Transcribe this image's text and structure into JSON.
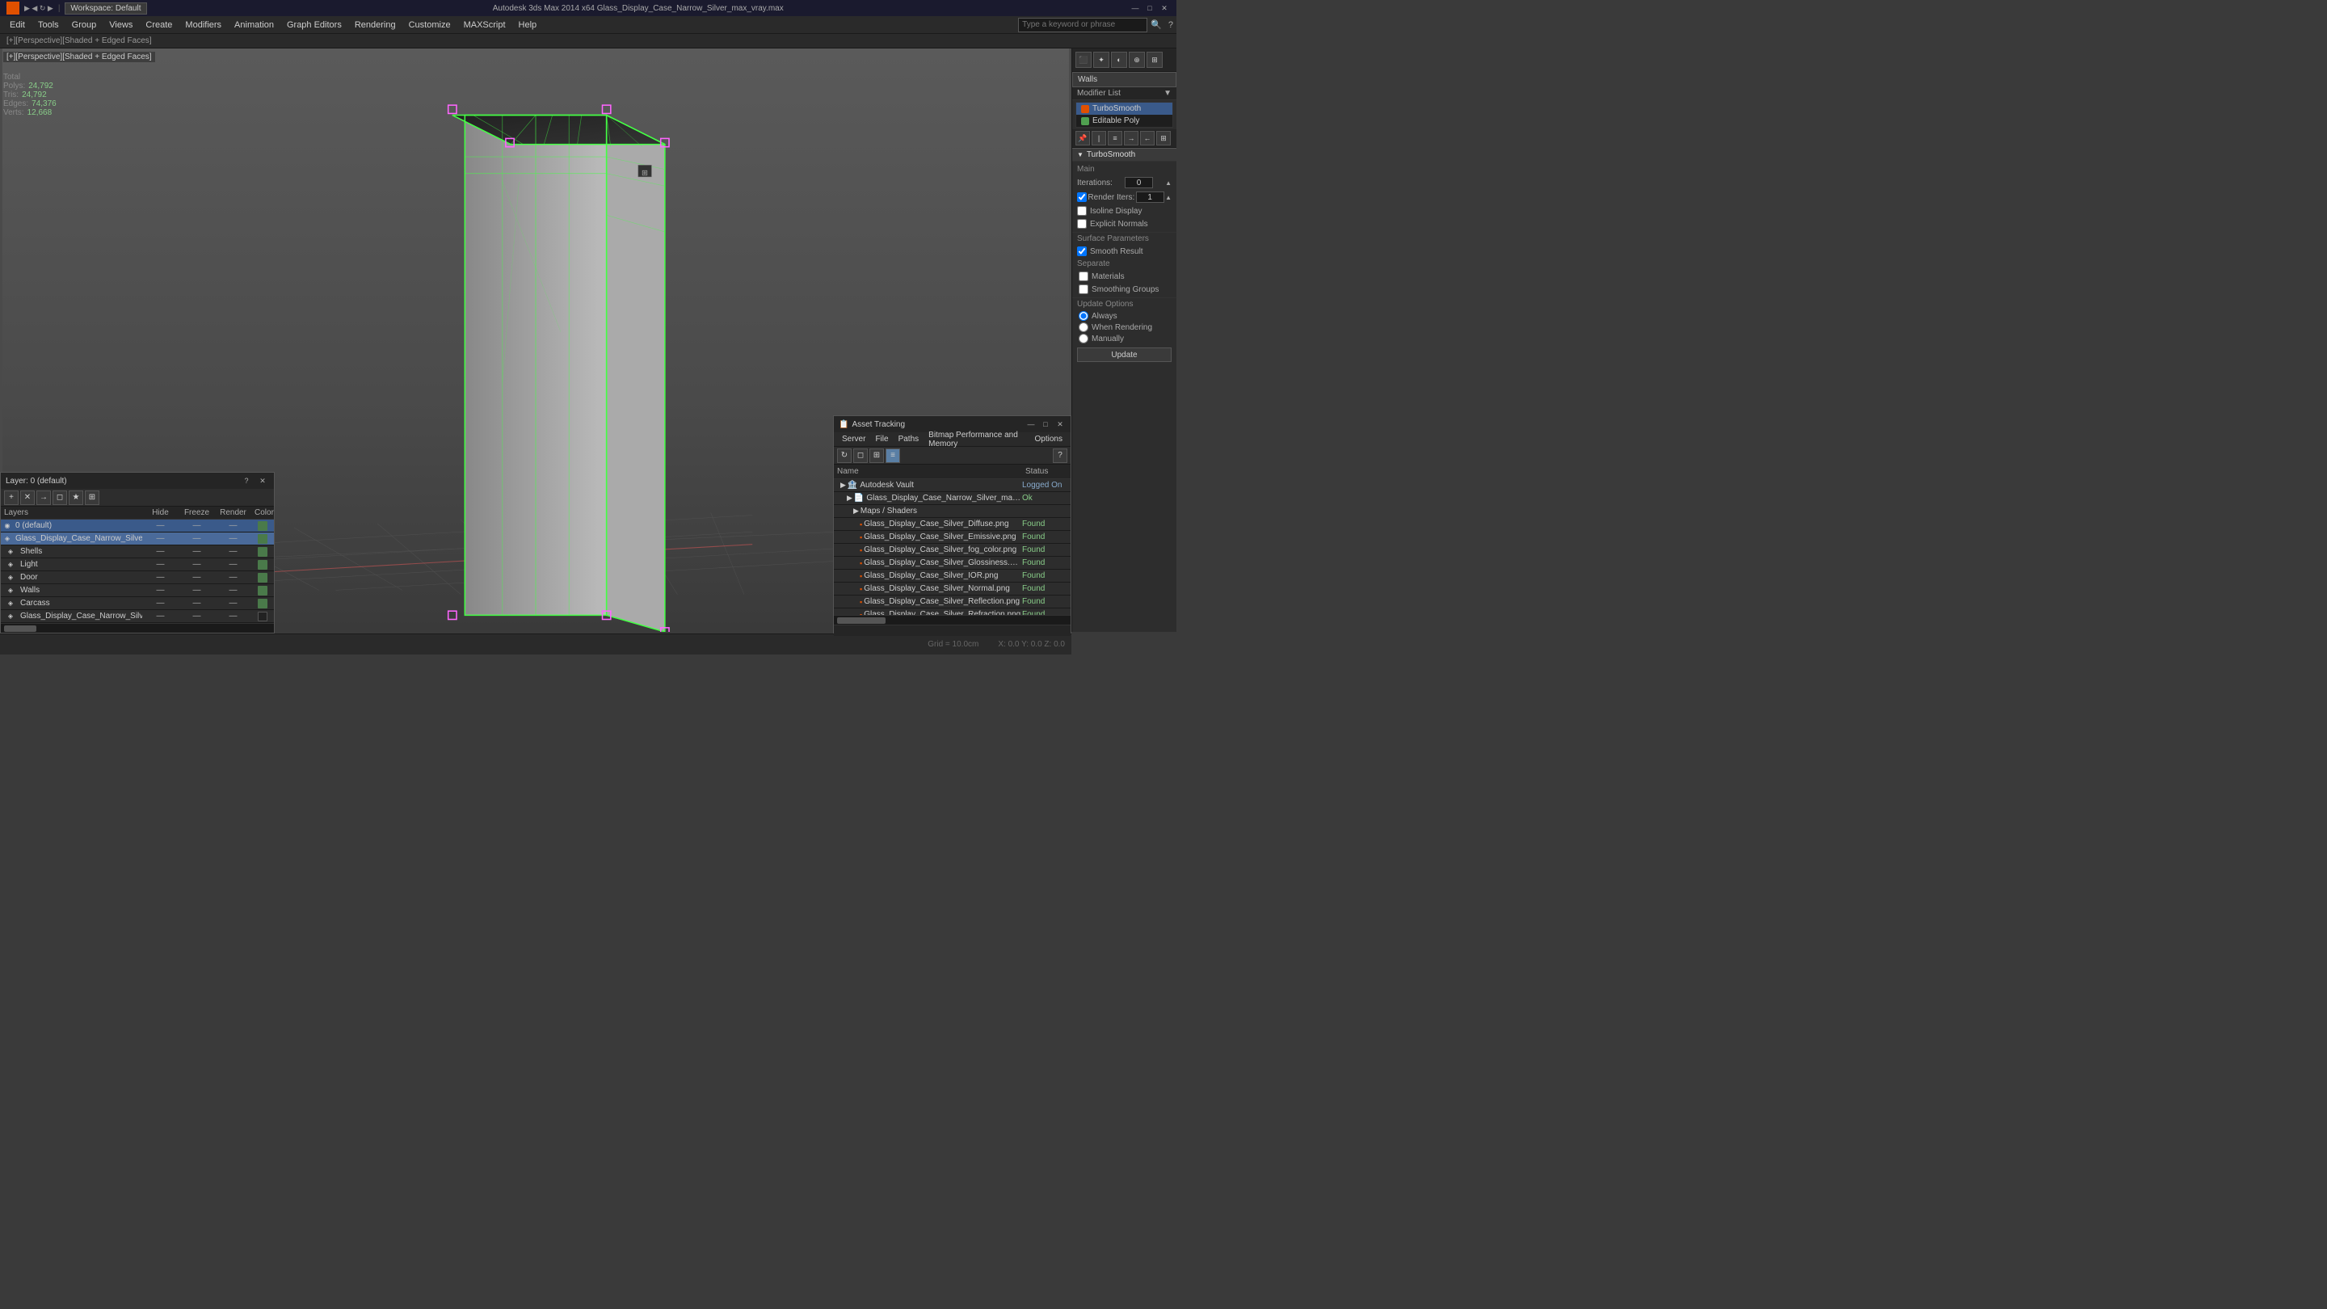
{
  "titlebar": {
    "title": "Glass_Display_Case_Narrow_Silver_max_vray.max",
    "app_title": "Autodesk 3ds Max 2014 x64",
    "full_title": "Autodesk 3ds Max 2014 x64    Glass_Display_Case_Narrow_Silver_max_vray.max",
    "minimize": "—",
    "maximize": "□",
    "close": "✕"
  },
  "toolbar": {
    "workspace_label": "Workspace: Default"
  },
  "menubar": {
    "items": [
      "Edit",
      "Tools",
      "Group",
      "Views",
      "Create",
      "Modifiers",
      "Animation",
      "Graph Editors",
      "Rendering",
      "Customize",
      "MAXScript",
      "Help"
    ],
    "search_placeholder": "Type a keyword or phrase"
  },
  "statusbar_top": {
    "label": "[+][Perspective][Shaded + Edged Faces]"
  },
  "stats": {
    "polys_label": "Polys:",
    "polys_val": "24,792",
    "tris_label": "Tris:",
    "tris_val": "24,792",
    "edges_label": "Edges:",
    "edges_val": "74,376",
    "verts_label": "Verts:",
    "verts_val": "12,668",
    "total_label": "Total"
  },
  "right_panel": {
    "object_name": "Walls",
    "modifier_list_label": "Modifier List",
    "modifiers": [
      {
        "name": "TurboSmooth",
        "type": "orange"
      },
      {
        "name": "Editable Poly",
        "type": "green"
      }
    ],
    "turbosmooth_title": "TurboSmooth",
    "main_label": "Main",
    "iterations_label": "Iterations:",
    "iterations_val": "0",
    "render_iters_label": "Render Iters:",
    "render_iters_val": "1",
    "render_iters_checked": true,
    "isoline_label": "Isoline Display",
    "isoline_checked": false,
    "explicit_normals_label": "Explicit Normals",
    "explicit_normals_checked": false,
    "surface_params_label": "Surface Parameters",
    "smooth_result_label": "Smooth Result",
    "smooth_result_checked": true,
    "separate_label": "Separate",
    "materials_label": "Materials",
    "materials_checked": false,
    "smoothing_groups_label": "Smoothing Groups",
    "smoothing_groups_checked": false,
    "update_options_label": "Update Options",
    "always_label": "Always",
    "always_checked": true,
    "when_rendering_label": "When Rendering",
    "when_rendering_checked": false,
    "manually_label": "Manually",
    "manually_checked": false,
    "update_btn": "Update"
  },
  "layers_panel": {
    "title": "Layer: 0 (default)",
    "layers_label": "Layers",
    "hide_col": "Hide",
    "freeze_col": "Freeze",
    "render_col": "Render",
    "color_col": "Color",
    "layers": [
      {
        "name": "0 (default)",
        "indent": 0,
        "active": true,
        "hide": "—",
        "freeze": "—",
        "render": "—",
        "color": "#4a7a4a"
      },
      {
        "name": "Glass_Display_Case_Narrow_Silver",
        "indent": 0,
        "active": false,
        "selected": true,
        "hide": "—",
        "freeze": "—",
        "render": "—",
        "color": "#4a7a4a"
      },
      {
        "name": "Shells",
        "indent": 1,
        "active": false,
        "hide": "—",
        "freeze": "—",
        "render": "—",
        "color": "#4a7a4a"
      },
      {
        "name": "Light",
        "indent": 1,
        "active": false,
        "hide": "—",
        "freeze": "—",
        "render": "—",
        "color": "#4a7a4a"
      },
      {
        "name": "Door",
        "indent": 1,
        "active": false,
        "hide": "—",
        "freeze": "—",
        "render": "—",
        "color": "#4a7a4a"
      },
      {
        "name": "Walls",
        "indent": 1,
        "active": false,
        "hide": "—",
        "freeze": "—",
        "render": "—",
        "color": "#4a7a4a"
      },
      {
        "name": "Carcass",
        "indent": 1,
        "active": false,
        "hide": "—",
        "freeze": "—",
        "render": "—",
        "color": "#4a7a4a"
      },
      {
        "name": "Glass_Display_Case_Narrow_Silver",
        "indent": 1,
        "active": false,
        "hide": "—",
        "freeze": "—",
        "render": "—",
        "color": "#222"
      }
    ]
  },
  "asset_panel": {
    "title": "Asset Tracking",
    "menu_items": [
      "Server",
      "File",
      "Paths",
      "Bitmap Performance and Memory",
      "Options"
    ],
    "name_col": "Name",
    "status_col": "Status",
    "groups": [
      {
        "name": "Autodesk Vault",
        "status": "Logged On",
        "children": [
          {
            "name": "Glass_Display_Case_Narrow_Silver_max_vray.max",
            "status": "Ok",
            "children": [
              {
                "name": "Maps / Shaders",
                "children": [
                  {
                    "name": "Glass_Display_Case_Silver_Diffuse.png",
                    "status": "Found"
                  },
                  {
                    "name": "Glass_Display_Case_Silver_Emissive.png",
                    "status": "Found"
                  },
                  {
                    "name": "Glass_Display_Case_Silver_fog_color.png",
                    "status": "Found"
                  },
                  {
                    "name": "Glass_Display_Case_Silver_Glossiness.png",
                    "status": "Found"
                  },
                  {
                    "name": "Glass_Display_Case_Silver_IOR.png",
                    "status": "Found"
                  },
                  {
                    "name": "Glass_Display_Case_Silver_Normal.png",
                    "status": "Found"
                  },
                  {
                    "name": "Glass_Display_Case_Silver_Reflection.png",
                    "status": "Found"
                  },
                  {
                    "name": "Glass_Display_Case_Silver_Refraction.png",
                    "status": "Found"
                  }
                ]
              }
            ]
          }
        ]
      }
    ]
  },
  "bottom": {
    "left_label": "",
    "grid_size": "Grid = 10.0cm",
    "coords": "X: 0.0  Y: 0.0  Z: 0.0"
  }
}
